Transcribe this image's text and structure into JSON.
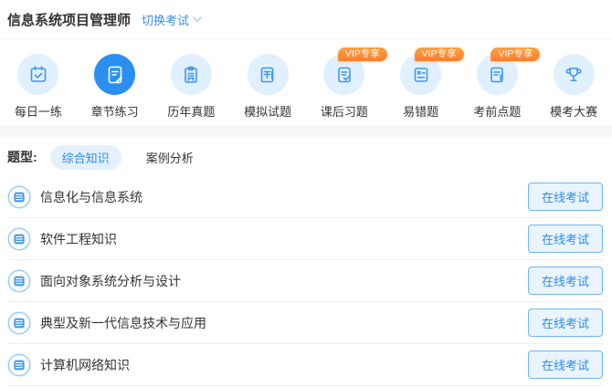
{
  "header": {
    "title": "信息系统项目管理师",
    "switch_label": "切换考试"
  },
  "nav": {
    "vip_badge_label": "VIP专享",
    "items": [
      {
        "label": "每日一练",
        "icon": "calendar-check-icon",
        "active": false,
        "vip": false
      },
      {
        "label": "章节练习",
        "icon": "document-pen-icon",
        "active": true,
        "vip": false
      },
      {
        "label": "历年真题",
        "icon": "clipboard-icon",
        "active": false,
        "vip": false
      },
      {
        "label": "模拟试题",
        "icon": "notebook-pen-icon",
        "active": false,
        "vip": false
      },
      {
        "label": "课后习题",
        "icon": "document-check-icon",
        "active": false,
        "vip": true
      },
      {
        "label": "易错题",
        "icon": "card-x-icon",
        "active": false,
        "vip": true
      },
      {
        "label": "考前点题",
        "icon": "document-pencil-icon",
        "active": false,
        "vip": true
      },
      {
        "label": "模考大赛",
        "icon": "trophy-icon",
        "active": false,
        "vip": false
      }
    ]
  },
  "filter": {
    "label": "题型:",
    "tabs": [
      {
        "label": "综合知识",
        "active": true
      },
      {
        "label": "案例分析",
        "active": false
      }
    ]
  },
  "chapters": {
    "action_label": "在线考试",
    "items": [
      "信息化与信息系统",
      "软件工程知识",
      "面向对象系统分析与设计",
      "典型及新一代信息技术与应用",
      "计算机网络知识"
    ]
  },
  "colors": {
    "accent_blue": "#2b8ff0",
    "light_blue_bg": "#e0f0fe",
    "link_blue": "#3a8ee6",
    "vip_orange": "#ff8a34",
    "divider": "#f0f0f0"
  }
}
